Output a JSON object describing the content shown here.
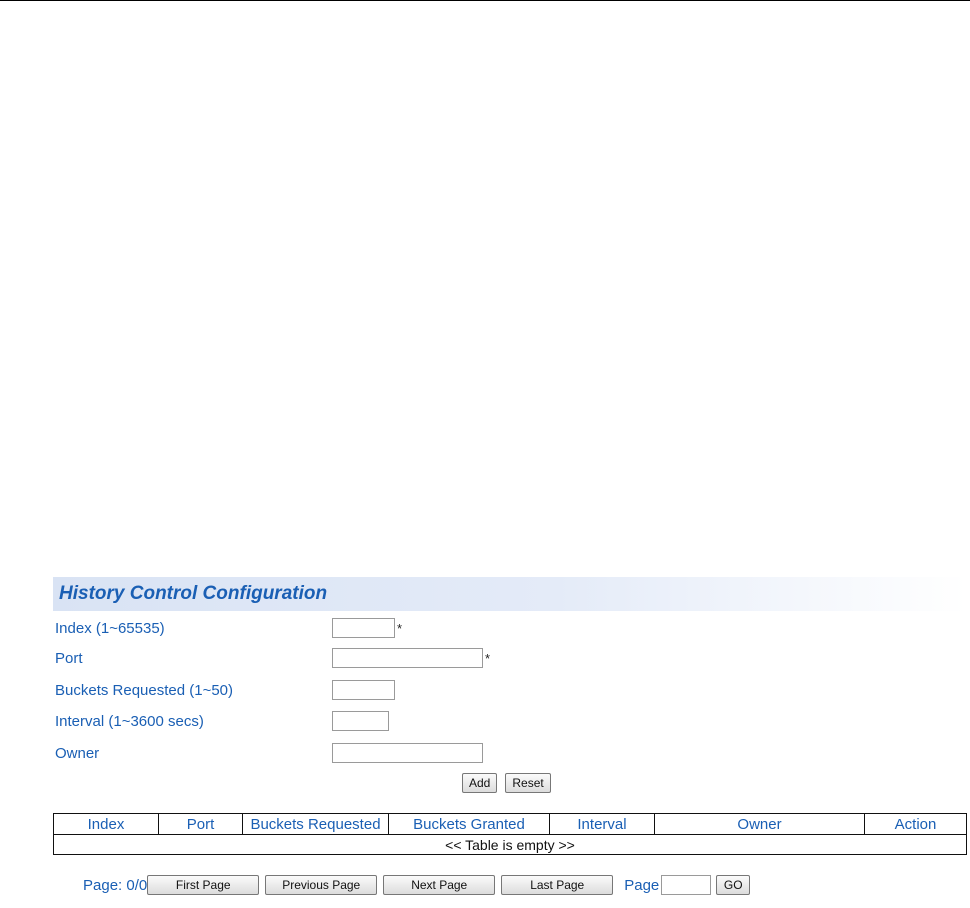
{
  "panel": {
    "title": "History Control Configuration"
  },
  "form": {
    "index": {
      "label": "Index (1~65535)",
      "value": "",
      "required_mark": "*"
    },
    "port": {
      "label": "Port",
      "value": "",
      "required_mark": "*"
    },
    "buckets_requested": {
      "label": "Buckets Requested (1~50)",
      "value": ""
    },
    "interval": {
      "label": "Interval (1~3600 secs)",
      "value": ""
    },
    "owner": {
      "label": "Owner",
      "value": ""
    },
    "add_label": "Add",
    "reset_label": "Reset"
  },
  "table": {
    "columns": [
      "Index",
      "Port",
      "Buckets Requested",
      "Buckets Granted",
      "Interval",
      "Owner",
      "Action"
    ],
    "empty_message": "<< Table is empty >>"
  },
  "pager": {
    "page_info": "Page: 0/0",
    "first_label": "First Page",
    "previous_label": "Previous Page",
    "next_label": "Next Page",
    "last_label": "Last Page",
    "goto_label": "Page",
    "goto_value": "",
    "go_label": "GO"
  }
}
